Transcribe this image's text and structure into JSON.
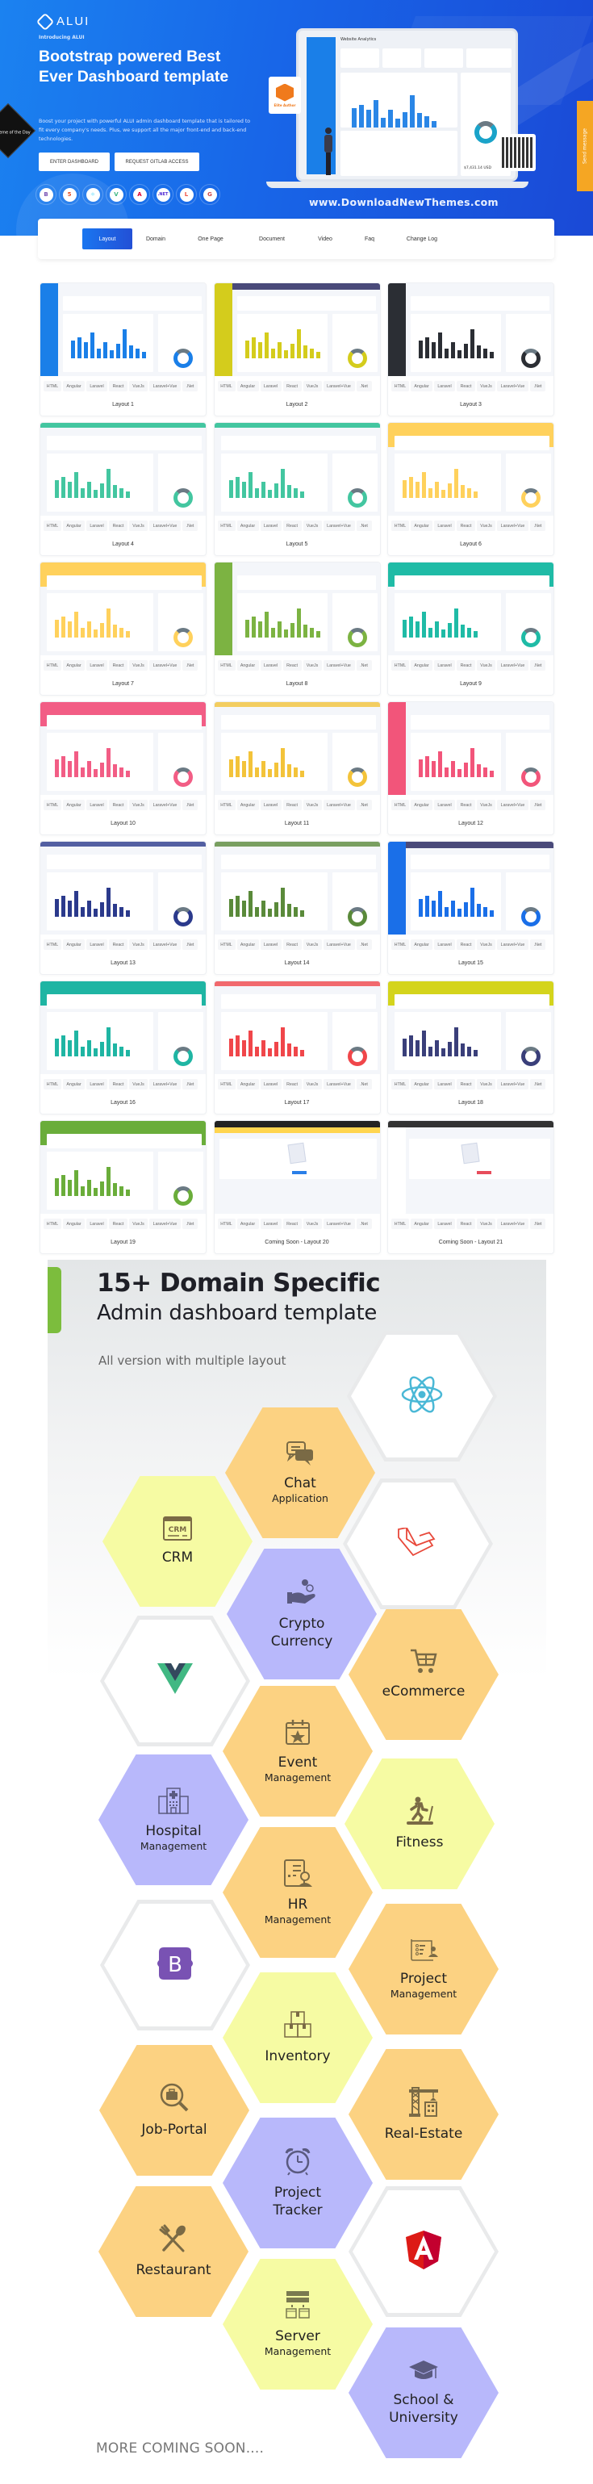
{
  "hero": {
    "brand": "ALUI",
    "intro": "Introducing ALUI",
    "title": "Bootstrap powered Best Ever Dashboard template",
    "description": "Boost your project with powerful ALUI admin dashboard template that is tailored to fit every company's needs. Plus, we support all the major front-end and back-end technologies.",
    "buttons": {
      "enter": "ENTER DASHBOARD",
      "gitlab": "REQUEST GITLAB ACCESS"
    },
    "tech_icons": [
      {
        "name": "bootstrap",
        "glyph": "B",
        "color": "#7952b3"
      },
      {
        "name": "html5",
        "glyph": "5",
        "color": "#e34f26"
      },
      {
        "name": "react",
        "glyph": "⚛",
        "color": "#61dafb"
      },
      {
        "name": "vue",
        "glyph": "V",
        "color": "#41b883"
      },
      {
        "name": "angular",
        "glyph": "A",
        "color": "#dd0031"
      },
      {
        "name": "dotnet",
        "glyph": ".NET",
        "color": "#512bd4"
      },
      {
        "name": "laravel",
        "glyph": "L",
        "color": "#f05340"
      },
      {
        "name": "gulp",
        "glyph": "G",
        "color": "#cf4647"
      }
    ],
    "theme_badge": "Theme of the Day",
    "elite_badge": "Elite Author",
    "site_url": "www.DownloadNewThemes.com",
    "send_message": "Send message",
    "preview": {
      "title": "Website Analytics",
      "amount": "$7,431.14 USD"
    }
  },
  "nav": {
    "items": [
      "Layout",
      "Domain",
      "One Page",
      "Document",
      "Video",
      "Faq",
      "Change Log"
    ],
    "active": "Layout"
  },
  "tech_chips": [
    "HTML",
    "Angular",
    "Laravel",
    "React",
    "VueJs",
    "Laravel+Vue",
    ".Net"
  ],
  "layouts": [
    {
      "title": "Layout 1",
      "theme": "#1a7fe8",
      "style": "sidebar"
    },
    {
      "title": "Layout 2",
      "theme": "#d4cc1c",
      "style": "sidebar-dark"
    },
    {
      "title": "Layout 3",
      "theme": "#2b2e34",
      "style": "sidebar"
    },
    {
      "title": "Layout 4",
      "theme": "#43c6a0",
      "style": "top"
    },
    {
      "title": "Layout 5",
      "theme": "#43c6a0",
      "style": "top"
    },
    {
      "title": "Layout 6",
      "theme": "#ffd15c",
      "style": "top"
    },
    {
      "title": "Layout 7",
      "theme": "#ffd15c",
      "style": "top"
    },
    {
      "title": "Layout 8",
      "theme": "#7cb342",
      "style": "sidebar"
    },
    {
      "title": "Layout 9",
      "theme": "#1fbba6",
      "style": "top"
    },
    {
      "title": "Layout 10",
      "theme": "#f25d85",
      "style": "top"
    },
    {
      "title": "Layout 11",
      "theme": "#f3c33a",
      "style": "light"
    },
    {
      "title": "Layout 12",
      "theme": "#f2557a",
      "style": "sidebar"
    },
    {
      "title": "Layout 13",
      "theme": "#2b3a8c",
      "style": "light"
    },
    {
      "title": "Layout 14",
      "theme": "#5a8a3a",
      "style": "light"
    },
    {
      "title": "Layout 15",
      "theme": "#1a6fe8",
      "style": "sidebar-dark"
    },
    {
      "title": "Layout 16",
      "theme": "#1fb5a3",
      "style": "top"
    },
    {
      "title": "Layout 17",
      "theme": "#f0464a",
      "style": "light"
    },
    {
      "title": "Layout 18",
      "theme": "#3a3f7a",
      "style": "top-yellow"
    },
    {
      "title": "Layout 19",
      "theme": "#6aad3a",
      "style": "top"
    },
    {
      "title": "Coming Soon - Layout 20",
      "theme": "#222",
      "style": "coming"
    },
    {
      "title": "Coming Soon - Layout 21",
      "theme": "#333",
      "style": "coming"
    }
  ],
  "domain": {
    "title_line1": "15+ Domain Specific",
    "title_line2": "Admin dashboard template",
    "subtitle": "All version with multiple layout",
    "tiles": [
      {
        "id": "react",
        "kind": "tech",
        "label1": "",
        "label2": ""
      },
      {
        "id": "chat",
        "kind": "domain",
        "label1": "Chat",
        "label2": "Application",
        "color": "#fcd282"
      },
      {
        "id": "laravel",
        "kind": "tech",
        "label1": "",
        "label2": ""
      },
      {
        "id": "crm",
        "kind": "domain",
        "label1": "CRM",
        "label2": "",
        "color": "#f6fba3"
      },
      {
        "id": "crypto",
        "kind": "domain",
        "label1": "Crypto",
        "label2": "Currency",
        "color": "#b8b8fb"
      },
      {
        "id": "vue",
        "kind": "tech",
        "label1": "",
        "label2": ""
      },
      {
        "id": "ecommerce",
        "kind": "domain",
        "label1": "eCommerce",
        "label2": "",
        "color": "#fcd282"
      },
      {
        "id": "event",
        "kind": "domain",
        "label1": "Event",
        "label2": "Management",
        "color": "#fcd282"
      },
      {
        "id": "hospital",
        "kind": "domain",
        "label1": "Hospital",
        "label2": "Management",
        "color": "#b8b8fb"
      },
      {
        "id": "fitness",
        "kind": "domain",
        "label1": "Fitness",
        "label2": "",
        "color": "#f6fba3"
      },
      {
        "id": "hr",
        "kind": "domain",
        "label1": "HR",
        "label2": "Management",
        "color": "#fcd282"
      },
      {
        "id": "bootstrap",
        "kind": "tech",
        "label1": "",
        "label2": ""
      },
      {
        "id": "project-management",
        "kind": "domain",
        "label1": "Project",
        "label2": "Management",
        "color": "#fcd282"
      },
      {
        "id": "inventory",
        "kind": "domain",
        "label1": "Inventory",
        "label2": "",
        "color": "#f6fba3"
      },
      {
        "id": "job-portal",
        "kind": "domain",
        "label1": "Job-Portal",
        "label2": "",
        "color": "#fcd282"
      },
      {
        "id": "real-estate",
        "kind": "domain",
        "label1": "Real-Estate",
        "label2": "",
        "color": "#fcd282"
      },
      {
        "id": "project-tracker",
        "kind": "domain",
        "label1": "Project",
        "label2": "Tracker",
        "color": "#b8b8fb"
      },
      {
        "id": "restaurant",
        "kind": "domain",
        "label1": "Restaurant",
        "label2": "",
        "color": "#fcd282"
      },
      {
        "id": "angular",
        "kind": "tech",
        "label1": "",
        "label2": ""
      },
      {
        "id": "server",
        "kind": "domain",
        "label1": "Server",
        "label2": "Management",
        "color": "#f6fba3"
      },
      {
        "id": "school",
        "kind": "domain",
        "label1": "School &",
        "label2": "University",
        "color": "#b8b8fb"
      }
    ],
    "more": "MORE COMING SOON...."
  }
}
